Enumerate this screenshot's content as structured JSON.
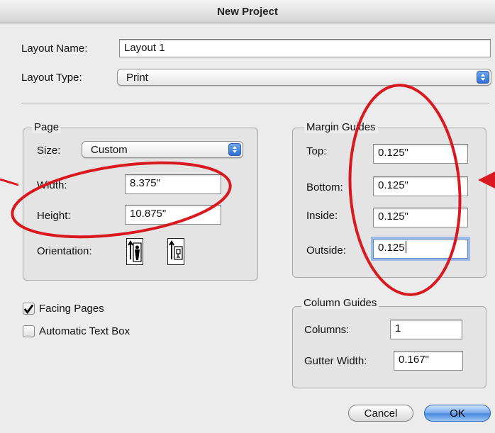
{
  "window": {
    "title": "New Project"
  },
  "layout": {
    "name_label": "Layout Name:",
    "name_value": "Layout 1",
    "type_label": "Layout Type:",
    "type_value": "Print"
  },
  "page": {
    "group_title": "Page",
    "size_label": "Size:",
    "size_value": "Custom",
    "width_label": "Width:",
    "width_value": "8.375\"",
    "height_label": "Height:",
    "height_value": "10.875\"",
    "orientation_label": "Orientation:"
  },
  "margin": {
    "group_title": "Margin Guides",
    "top_label": "Top:",
    "top_value": "0.125\"",
    "bottom_label": "Bottom:",
    "bottom_value": "0.125\"",
    "inside_label": "Inside:",
    "inside_value": "0.125\"",
    "outside_label": "Outside:",
    "outside_value": "0.125"
  },
  "options": {
    "facing_pages_label": "Facing Pages",
    "facing_pages_checked": true,
    "auto_text_box_label": "Automatic Text Box",
    "auto_text_box_checked": false
  },
  "column": {
    "group_title": "Column Guides",
    "columns_label": "Columns:",
    "columns_value": "1",
    "gutter_label": "Gutter Width:",
    "gutter_value": "0.167\""
  },
  "buttons": {
    "cancel": "Cancel",
    "ok": "OK"
  },
  "colors": {
    "annotation_red": "#d9191f",
    "aqua_blue": "#3b7ddb",
    "dialog_bg": "#ececec"
  }
}
